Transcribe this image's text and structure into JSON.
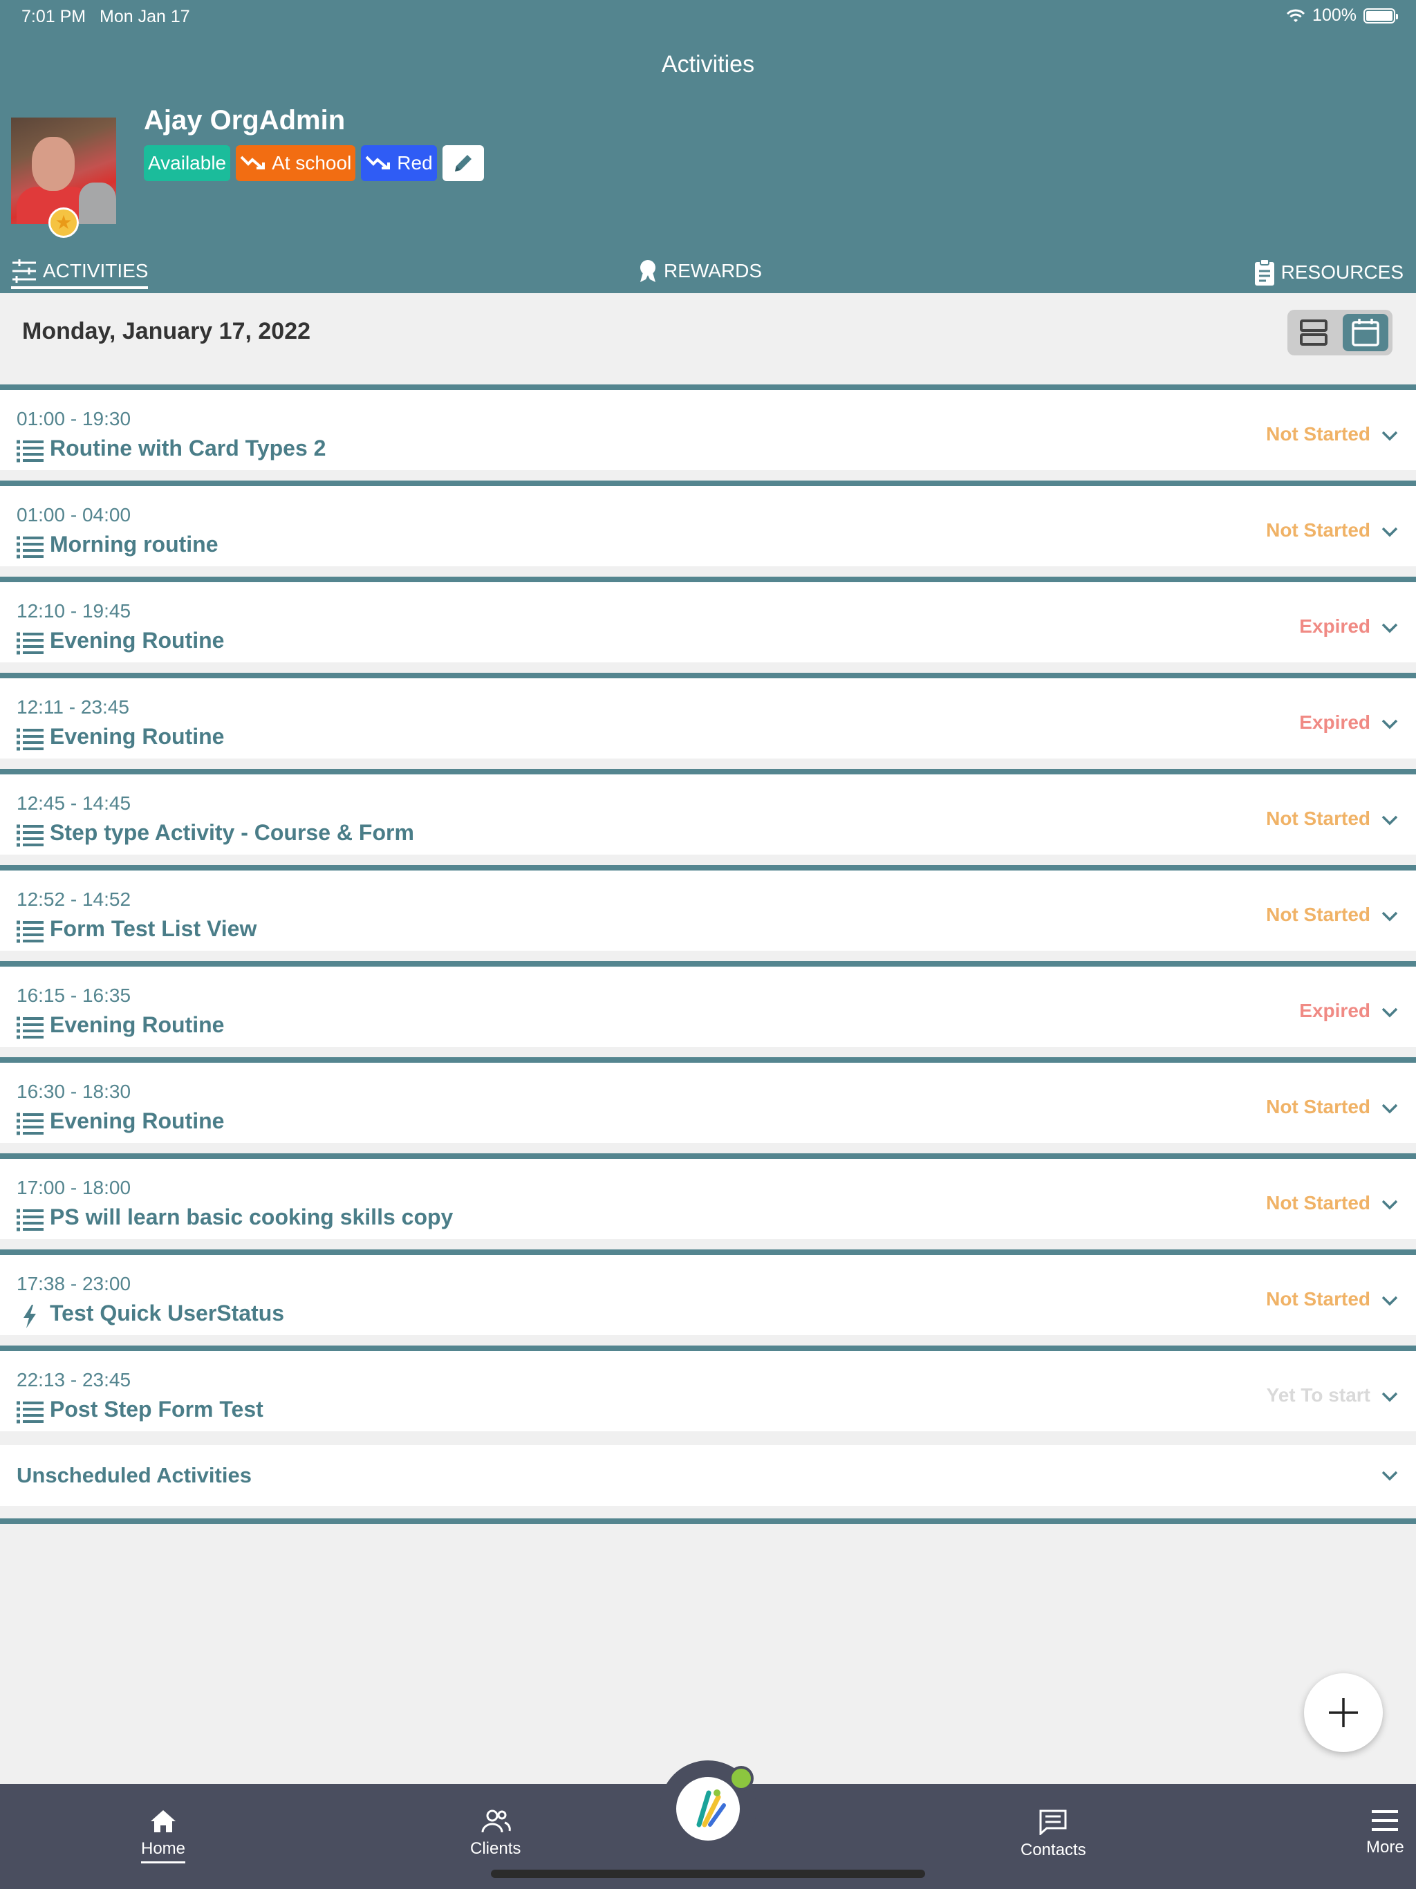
{
  "status_bar": {
    "time": "7:01 PM",
    "date": "Mon Jan 17",
    "battery": "100%"
  },
  "nav": {
    "title": "Activities"
  },
  "user": {
    "name": "Ajay OrgAdmin",
    "chips": {
      "available": "Available",
      "location": "At school",
      "zone": "Red"
    }
  },
  "tabs": {
    "activities": "ACTIVITIES",
    "rewards": "REWARDS",
    "resources": "RESOURCES"
  },
  "date_header": "Monday, January 17, 2022",
  "activities": [
    {
      "time": "01:00 - 19:30",
      "title": "Routine with Card Types 2",
      "status": "Not Started",
      "icon": "list-icon"
    },
    {
      "time": "01:00 - 04:00",
      "title": "Morning routine",
      "status": "Not Started",
      "icon": "list-icon"
    },
    {
      "time": "12:10 - 19:45",
      "title": "Evening Routine",
      "status": "Expired",
      "icon": "list-icon"
    },
    {
      "time": "12:11 - 23:45",
      "title": "Evening Routine",
      "status": "Expired",
      "icon": "list-icon"
    },
    {
      "time": "12:45 - 14:45",
      "title": "Step type Activity - Course & Form",
      "status": "Not Started",
      "icon": "list-icon"
    },
    {
      "time": "12:52 - 14:52",
      "title": "Form Test List View",
      "status": "Not Started",
      "icon": "list-icon"
    },
    {
      "time": "16:15 - 16:35",
      "title": "Evening Routine",
      "status": "Expired",
      "icon": "list-icon"
    },
    {
      "time": "16:30 - 18:30",
      "title": "Evening Routine",
      "status": "Not Started",
      "icon": "list-icon"
    },
    {
      "time": "17:00 - 18:00",
      "title": "PS will learn basic cooking skills copy",
      "status": "Not Started",
      "icon": "list-icon"
    },
    {
      "time": "17:38 - 23:00",
      "title": "Test Quick UserStatus",
      "status": "Not Started",
      "icon": "lightning-icon"
    },
    {
      "time": "22:13 - 23:45",
      "title": "Post Step Form Test",
      "status": "Yet To start",
      "icon": "list-icon"
    }
  ],
  "unscheduled": {
    "label": "Unscheduled Activities"
  },
  "bottom_nav": {
    "home": "Home",
    "clients": "Clients",
    "contacts": "Contacts",
    "more": "More"
  },
  "colors": {
    "primary": "#54858f",
    "not_started": "#f0b266",
    "expired": "#f08a84",
    "yet_to_start": "#d9d9d9",
    "nav_bg": "#4a4e5f"
  }
}
